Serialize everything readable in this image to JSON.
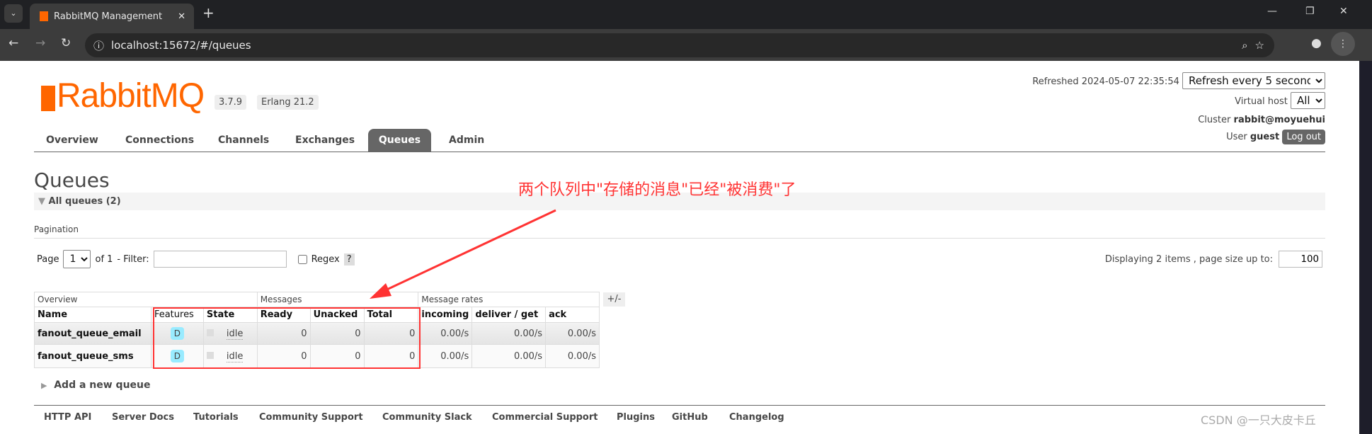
{
  "browser": {
    "tab_title": "RabbitMQ Management",
    "url": "localhost:15672/#/queues"
  },
  "header": {
    "logo_text": "RabbitMQ",
    "version": "3.7.9",
    "erlang": "Erlang 21.2",
    "refreshed": "Refreshed 2024-05-07 22:35:54",
    "refresh_option": "Refresh every 5 seconds",
    "vhost_label": "Virtual host",
    "vhost_value": "All",
    "cluster_label": "Cluster",
    "cluster_value": "rabbit@moyuehui",
    "user_label": "User",
    "user_value": "guest",
    "logout": "Log out"
  },
  "nav": [
    "Overview",
    "Connections",
    "Channels",
    "Exchanges",
    "Queues",
    "Admin"
  ],
  "page": {
    "title": "Queues",
    "section": "All queues (2)",
    "pagination_label": "Pagination",
    "page_label": "Page",
    "page_value": "1",
    "of": "of 1",
    "filter_label": "- Filter:",
    "filter_value": "",
    "regex": "Regex",
    "help": "?",
    "displaying": "Displaying 2 items , page size up to:",
    "page_size": "100",
    "plus_minus": "+/-",
    "add_queue": "Add a new queue"
  },
  "table": {
    "groups": [
      "Overview",
      "Messages",
      "Message rates"
    ],
    "columns": [
      "Name",
      "Features",
      "State",
      "Ready",
      "Unacked",
      "Total",
      "incoming",
      "deliver / get",
      "ack"
    ],
    "rows": [
      {
        "name": "fanout_queue_email",
        "features": "D",
        "state": "idle",
        "ready": "0",
        "unacked": "0",
        "total": "0",
        "incoming": "0.00/s",
        "deliver": "0.00/s",
        "ack": "0.00/s"
      },
      {
        "name": "fanout_queue_sms",
        "features": "D",
        "state": "idle",
        "ready": "0",
        "unacked": "0",
        "total": "0",
        "incoming": "0.00/s",
        "deliver": "0.00/s",
        "ack": "0.00/s"
      }
    ]
  },
  "annotation": "两个队列中\"存储的消息\"已经\"被消费\"了",
  "footer": [
    "HTTP API",
    "Server Docs",
    "Tutorials",
    "Community Support",
    "Community Slack",
    "Commercial Support",
    "Plugins",
    "GitHub",
    "Changelog"
  ],
  "watermark": "CSDN @一只大皮卡丘",
  "colors": {
    "brand": "#f60",
    "annotation": "#ff3333"
  }
}
